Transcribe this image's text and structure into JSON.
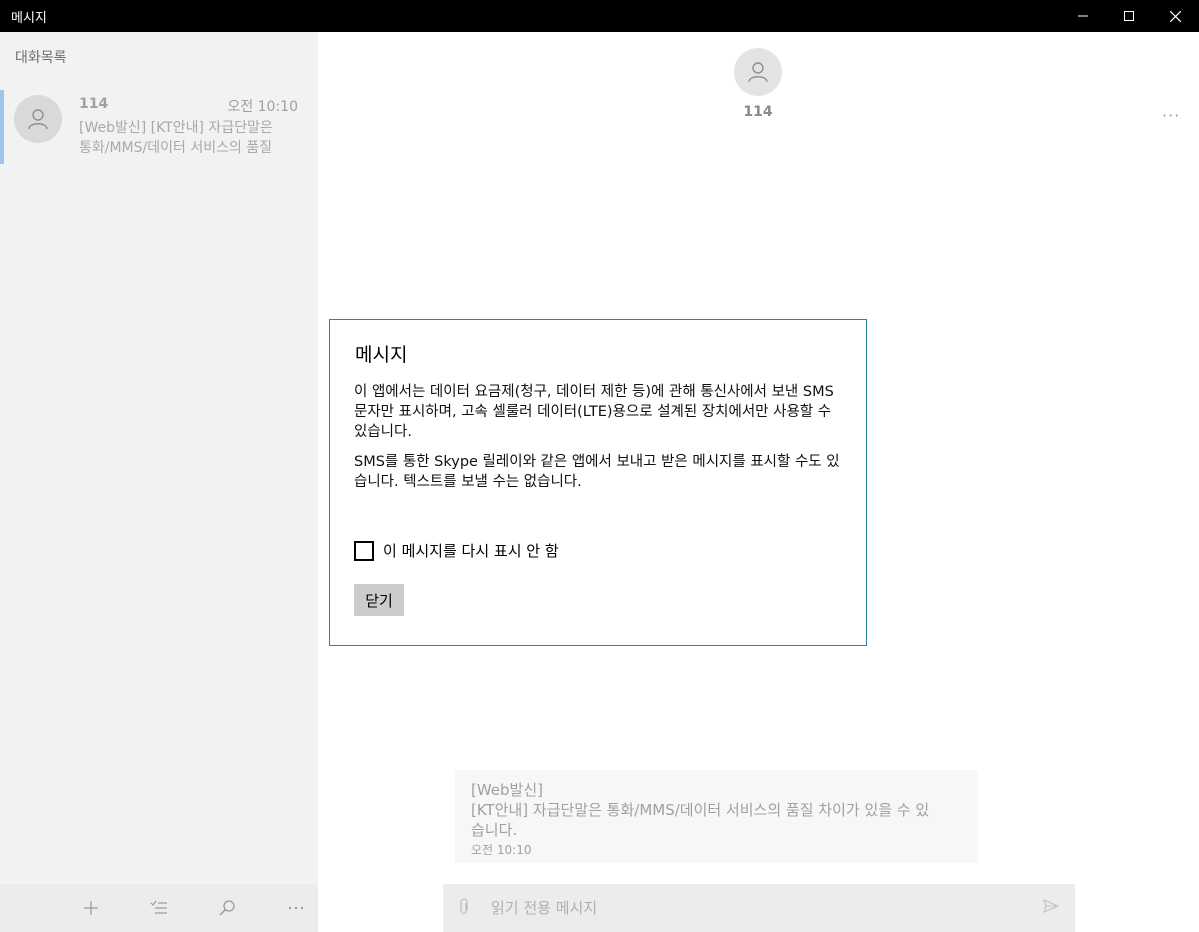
{
  "window": {
    "title": "메시지"
  },
  "sidebar": {
    "heading": "대화목록",
    "conversations": [
      {
        "name": "114",
        "time": "오전 10:10",
        "preview_line1": "[Web발신] [KT안내] 자급단말은",
        "preview_line2": "통화/MMS/데이터 서비스의 품질"
      }
    ],
    "toolbar": {
      "new_icon": "plus-icon",
      "select_icon": "select-list-icon",
      "search_icon": "search-icon",
      "more_icon": "more-icon"
    }
  },
  "conversation": {
    "contact_name": "114",
    "more_label": "···",
    "message": {
      "line1": "[Web발신]",
      "line2": "[KT안내] 자급단말은 통화/MMS/데이터 서비스의 품질 차이가 있을 수 있",
      "line3": "습니다.",
      "time": "오전 10:10"
    },
    "composer": {
      "placeholder": "읽기 전용 메시지"
    }
  },
  "dialog": {
    "title": "메시지",
    "paragraph1": "이 앱에서는 데이터 요금제(청구, 데이터 제한 등)에 관해 통신사에서 보낸 SMS 문자만 표시하며, 고속 셀룰러 데이터(LTE)용으로 설계된 장치에서만 사용할 수 있습니다.",
    "paragraph2": "SMS를 통한 Skype 릴레이와 같은 앱에서 보내고 받은 메시지를 표시할 수도 있습니다. 텍스트를 보낼 수는 없습니다.",
    "checkbox_label": "이 메시지를 다시 표시 안 함",
    "checkbox_checked": false,
    "close_label": "닫기"
  },
  "colors": {
    "titlebar": "#000000",
    "sidebar_bg": "#f2f2f2",
    "selection_accent": "#9fc6ea",
    "dialog_border": "#2a86a8"
  }
}
